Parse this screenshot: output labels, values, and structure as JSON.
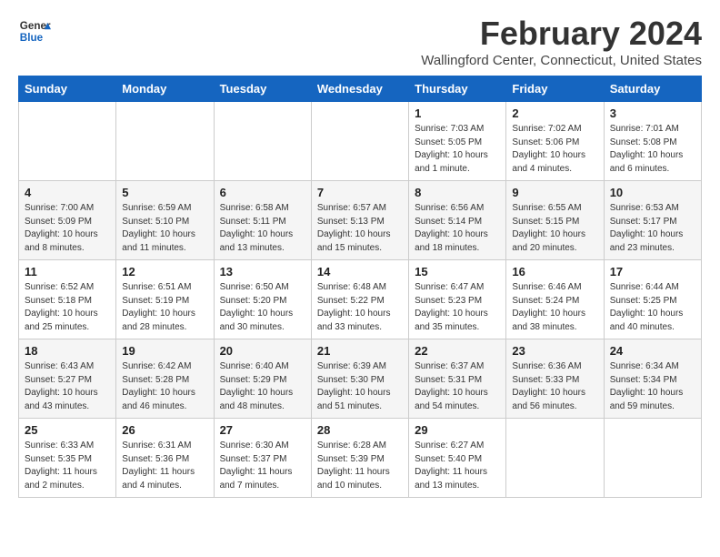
{
  "header": {
    "logo_line1": "General",
    "logo_line2": "Blue",
    "month_year": "February 2024",
    "location": "Wallingford Center, Connecticut, United States"
  },
  "days_of_week": [
    "Sunday",
    "Monday",
    "Tuesday",
    "Wednesday",
    "Thursday",
    "Friday",
    "Saturday"
  ],
  "weeks": [
    [
      {
        "day": "",
        "info": ""
      },
      {
        "day": "",
        "info": ""
      },
      {
        "day": "",
        "info": ""
      },
      {
        "day": "",
        "info": ""
      },
      {
        "day": "1",
        "info": "Sunrise: 7:03 AM\nSunset: 5:05 PM\nDaylight: 10 hours\nand 1 minute."
      },
      {
        "day": "2",
        "info": "Sunrise: 7:02 AM\nSunset: 5:06 PM\nDaylight: 10 hours\nand 4 minutes."
      },
      {
        "day": "3",
        "info": "Sunrise: 7:01 AM\nSunset: 5:08 PM\nDaylight: 10 hours\nand 6 minutes."
      }
    ],
    [
      {
        "day": "4",
        "info": "Sunrise: 7:00 AM\nSunset: 5:09 PM\nDaylight: 10 hours\nand 8 minutes."
      },
      {
        "day": "5",
        "info": "Sunrise: 6:59 AM\nSunset: 5:10 PM\nDaylight: 10 hours\nand 11 minutes."
      },
      {
        "day": "6",
        "info": "Sunrise: 6:58 AM\nSunset: 5:11 PM\nDaylight: 10 hours\nand 13 minutes."
      },
      {
        "day": "7",
        "info": "Sunrise: 6:57 AM\nSunset: 5:13 PM\nDaylight: 10 hours\nand 15 minutes."
      },
      {
        "day": "8",
        "info": "Sunrise: 6:56 AM\nSunset: 5:14 PM\nDaylight: 10 hours\nand 18 minutes."
      },
      {
        "day": "9",
        "info": "Sunrise: 6:55 AM\nSunset: 5:15 PM\nDaylight: 10 hours\nand 20 minutes."
      },
      {
        "day": "10",
        "info": "Sunrise: 6:53 AM\nSunset: 5:17 PM\nDaylight: 10 hours\nand 23 minutes."
      }
    ],
    [
      {
        "day": "11",
        "info": "Sunrise: 6:52 AM\nSunset: 5:18 PM\nDaylight: 10 hours\nand 25 minutes."
      },
      {
        "day": "12",
        "info": "Sunrise: 6:51 AM\nSunset: 5:19 PM\nDaylight: 10 hours\nand 28 minutes."
      },
      {
        "day": "13",
        "info": "Sunrise: 6:50 AM\nSunset: 5:20 PM\nDaylight: 10 hours\nand 30 minutes."
      },
      {
        "day": "14",
        "info": "Sunrise: 6:48 AM\nSunset: 5:22 PM\nDaylight: 10 hours\nand 33 minutes."
      },
      {
        "day": "15",
        "info": "Sunrise: 6:47 AM\nSunset: 5:23 PM\nDaylight: 10 hours\nand 35 minutes."
      },
      {
        "day": "16",
        "info": "Sunrise: 6:46 AM\nSunset: 5:24 PM\nDaylight: 10 hours\nand 38 minutes."
      },
      {
        "day": "17",
        "info": "Sunrise: 6:44 AM\nSunset: 5:25 PM\nDaylight: 10 hours\nand 40 minutes."
      }
    ],
    [
      {
        "day": "18",
        "info": "Sunrise: 6:43 AM\nSunset: 5:27 PM\nDaylight: 10 hours\nand 43 minutes."
      },
      {
        "day": "19",
        "info": "Sunrise: 6:42 AM\nSunset: 5:28 PM\nDaylight: 10 hours\nand 46 minutes."
      },
      {
        "day": "20",
        "info": "Sunrise: 6:40 AM\nSunset: 5:29 PM\nDaylight: 10 hours\nand 48 minutes."
      },
      {
        "day": "21",
        "info": "Sunrise: 6:39 AM\nSunset: 5:30 PM\nDaylight: 10 hours\nand 51 minutes."
      },
      {
        "day": "22",
        "info": "Sunrise: 6:37 AM\nSunset: 5:31 PM\nDaylight: 10 hours\nand 54 minutes."
      },
      {
        "day": "23",
        "info": "Sunrise: 6:36 AM\nSunset: 5:33 PM\nDaylight: 10 hours\nand 56 minutes."
      },
      {
        "day": "24",
        "info": "Sunrise: 6:34 AM\nSunset: 5:34 PM\nDaylight: 10 hours\nand 59 minutes."
      }
    ],
    [
      {
        "day": "25",
        "info": "Sunrise: 6:33 AM\nSunset: 5:35 PM\nDaylight: 11 hours\nand 2 minutes."
      },
      {
        "day": "26",
        "info": "Sunrise: 6:31 AM\nSunset: 5:36 PM\nDaylight: 11 hours\nand 4 minutes."
      },
      {
        "day": "27",
        "info": "Sunrise: 6:30 AM\nSunset: 5:37 PM\nDaylight: 11 hours\nand 7 minutes."
      },
      {
        "day": "28",
        "info": "Sunrise: 6:28 AM\nSunset: 5:39 PM\nDaylight: 11 hours\nand 10 minutes."
      },
      {
        "day": "29",
        "info": "Sunrise: 6:27 AM\nSunset: 5:40 PM\nDaylight: 11 hours\nand 13 minutes."
      },
      {
        "day": "",
        "info": ""
      },
      {
        "day": "",
        "info": ""
      }
    ]
  ]
}
